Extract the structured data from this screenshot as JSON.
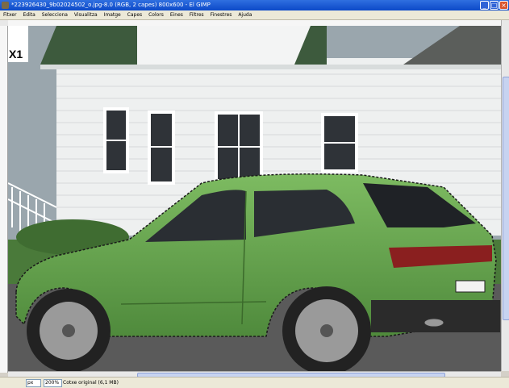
{
  "window": {
    "title": "*223926430_9b02024502_o.jpg-8.0 (RGB, 2 capes) 800x600 - El GIMP",
    "minimize_label": "_",
    "maximize_label": "□",
    "close_label": "×"
  },
  "menu": {
    "items": [
      "Fitxer",
      "Edita",
      "Selecciona",
      "Visualitza",
      "Imatge",
      "Capes",
      "Colors",
      "Eines",
      "Filtres",
      "Finestres",
      "Ajuda"
    ]
  },
  "image": {
    "label": "X1",
    "colors": {
      "car_body": "#6aa74e",
      "siding": "#f1f2f2",
      "roof": "#3d5a3d",
      "sky": "#9aa6ad",
      "grass": "#4a7a3a"
    }
  },
  "status": {
    "unit": "px",
    "zoom": "200%",
    "text": "Cotxe original (6,1 MB)"
  }
}
